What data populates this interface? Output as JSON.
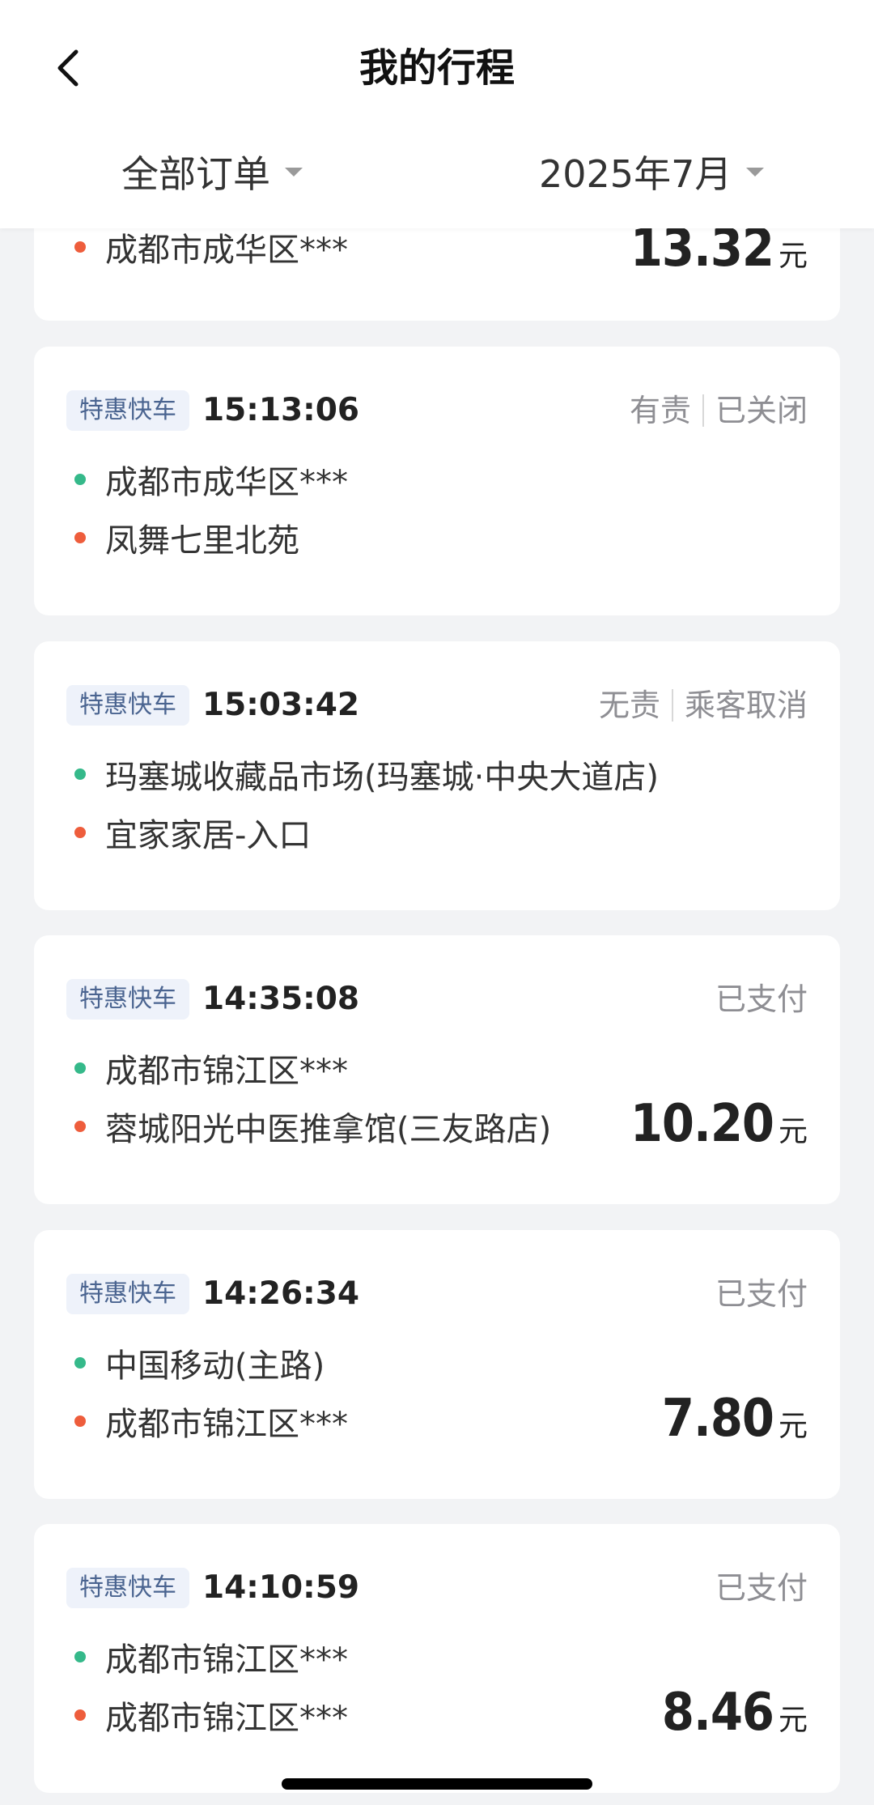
{
  "header": {
    "title": "我的行程",
    "filter_orders": "全部订单",
    "filter_month": "2025年7月"
  },
  "orders": [
    {
      "tag": "",
      "time": "",
      "status": [],
      "from": "",
      "to": "成都市成华区***",
      "price": "13.32",
      "unit": "元"
    },
    {
      "tag": "特惠快车",
      "time": "15:13:06",
      "status": [
        "有责",
        "已关闭"
      ],
      "from": "成都市成华区***",
      "to": "凤舞七里北苑",
      "price": "",
      "unit": ""
    },
    {
      "tag": "特惠快车",
      "time": "15:03:42",
      "status": [
        "无责",
        "乘客取消"
      ],
      "from": "玛塞城收藏品市场(玛塞城·中央大道店)",
      "to": "宜家家居-入口",
      "price": "",
      "unit": ""
    },
    {
      "tag": "特惠快车",
      "time": "14:35:08",
      "status": [
        "已支付"
      ],
      "from": "成都市锦江区***",
      "to": "蓉城阳光中医推拿馆(三友路店)",
      "price": "10.20",
      "unit": "元"
    },
    {
      "tag": "特惠快车",
      "time": "14:26:34",
      "status": [
        "已支付"
      ],
      "from": "中国移动(主路)",
      "to": "成都市锦江区***",
      "price": "7.80",
      "unit": "元"
    },
    {
      "tag": "特惠快车",
      "time": "14:10:59",
      "status": [
        "已支付"
      ],
      "from": "成都市锦江区***",
      "to": "成都市锦江区***",
      "price": "8.46",
      "unit": "元"
    }
  ]
}
